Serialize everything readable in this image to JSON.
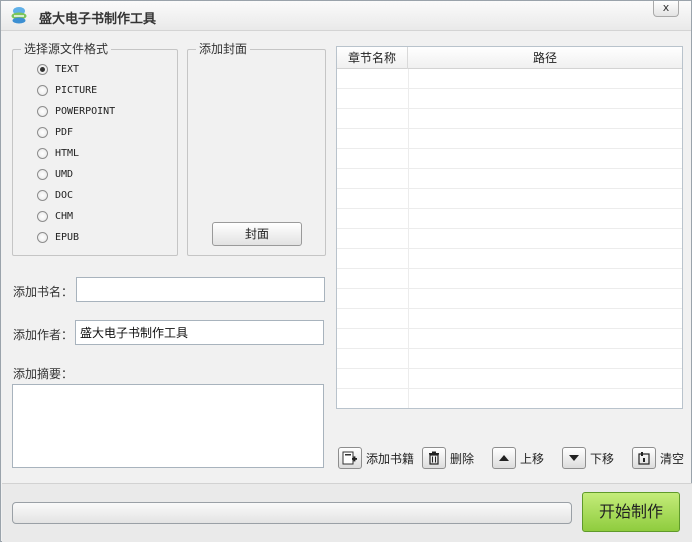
{
  "window": {
    "title": "盛大电子书制作工具",
    "close_label": "x"
  },
  "source_format": {
    "legend": "选择源文件格式",
    "options": [
      "TEXT",
      "PICTURE",
      "POWERPOINT",
      "PDF",
      "HTML",
      "UMD",
      "DOC",
      "CHM",
      "EPUB"
    ],
    "selected": "TEXT"
  },
  "cover": {
    "legend": "添加封面",
    "button_label": "封面"
  },
  "book_name": {
    "label": "添加书名：",
    "value": ""
  },
  "author": {
    "label": "添加作者：",
    "value": "盛大电子书制作工具"
  },
  "summary": {
    "label": "添加摘要：",
    "value": ""
  },
  "chapter_table": {
    "columns": [
      "章节名称",
      "路径"
    ],
    "rows": []
  },
  "toolbar": {
    "add_book": "添加书籍",
    "delete": "删除",
    "move_up": "上移",
    "move_down": "下移",
    "clear": "清空"
  },
  "progress": {
    "value": 0
  },
  "start_button": "开始制作",
  "colors": {
    "start_button": "#9dd44a",
    "window_bg": "#f1f1f1"
  },
  "icons": {
    "app": "cloud-book-icon",
    "add_book": "add-book-icon",
    "delete": "trash-icon",
    "move_up": "arrow-up-icon",
    "move_down": "arrow-down-icon",
    "clear": "clear-icon"
  }
}
